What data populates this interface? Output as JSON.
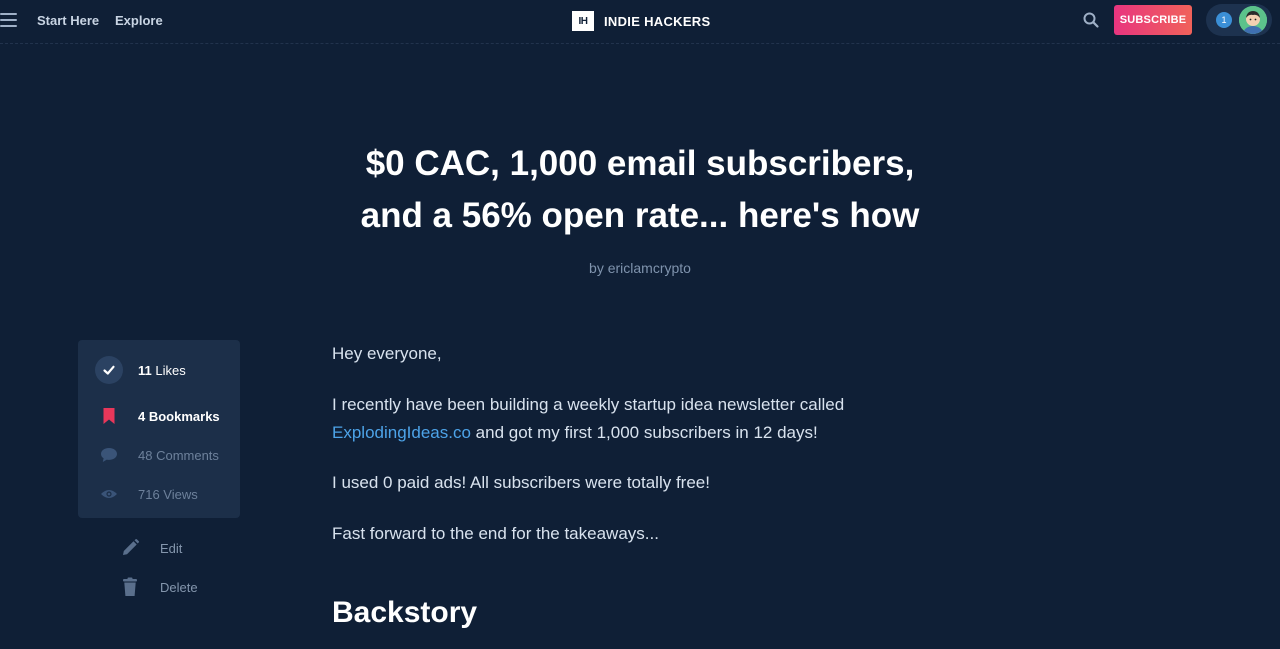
{
  "header": {
    "nav": [
      "Start Here",
      "Explore"
    ],
    "brand_logo": "IH",
    "brand_name": "INDIE HACKERS",
    "subscribe_label": "SUBSCRIBE",
    "notification_count": "1",
    "search_icon": "search-icon",
    "menu_icon": "hamburger-menu-icon",
    "accent_gradient": [
      "#e8357f",
      "#f0625a"
    ]
  },
  "post": {
    "title_line1": "$0 CAC, 1,000 email subscribers,",
    "title_line2": "and a 56% open rate... here's how",
    "author_prefix": "by",
    "author": "ericlamcrypto"
  },
  "stats": {
    "likes_count": "11",
    "likes_label": "Likes",
    "bookmarks_label": "4 Bookmarks",
    "comments_label": "48 Comments",
    "views_label": "716 Views",
    "bookmark_color": "#e8375a"
  },
  "actions": {
    "edit_label": "Edit",
    "delete_label": "Delete"
  },
  "article": {
    "p1": "Hey everyone,",
    "p2_before": "I recently have been building a weekly startup idea newsletter called",
    "p2_link": "ExplodingIdeas.co",
    "p2_after": " and got my first 1,000 subscribers in 12 days!",
    "p3": "I used 0 paid ads! All subscribers were totally free!",
    "p4": "Fast forward to the end for the takeaways...",
    "h2": "Backstory",
    "link_color": "#4da3e8"
  },
  "colors": {
    "background": "#0f1f36",
    "card": "#1c2f49"
  }
}
